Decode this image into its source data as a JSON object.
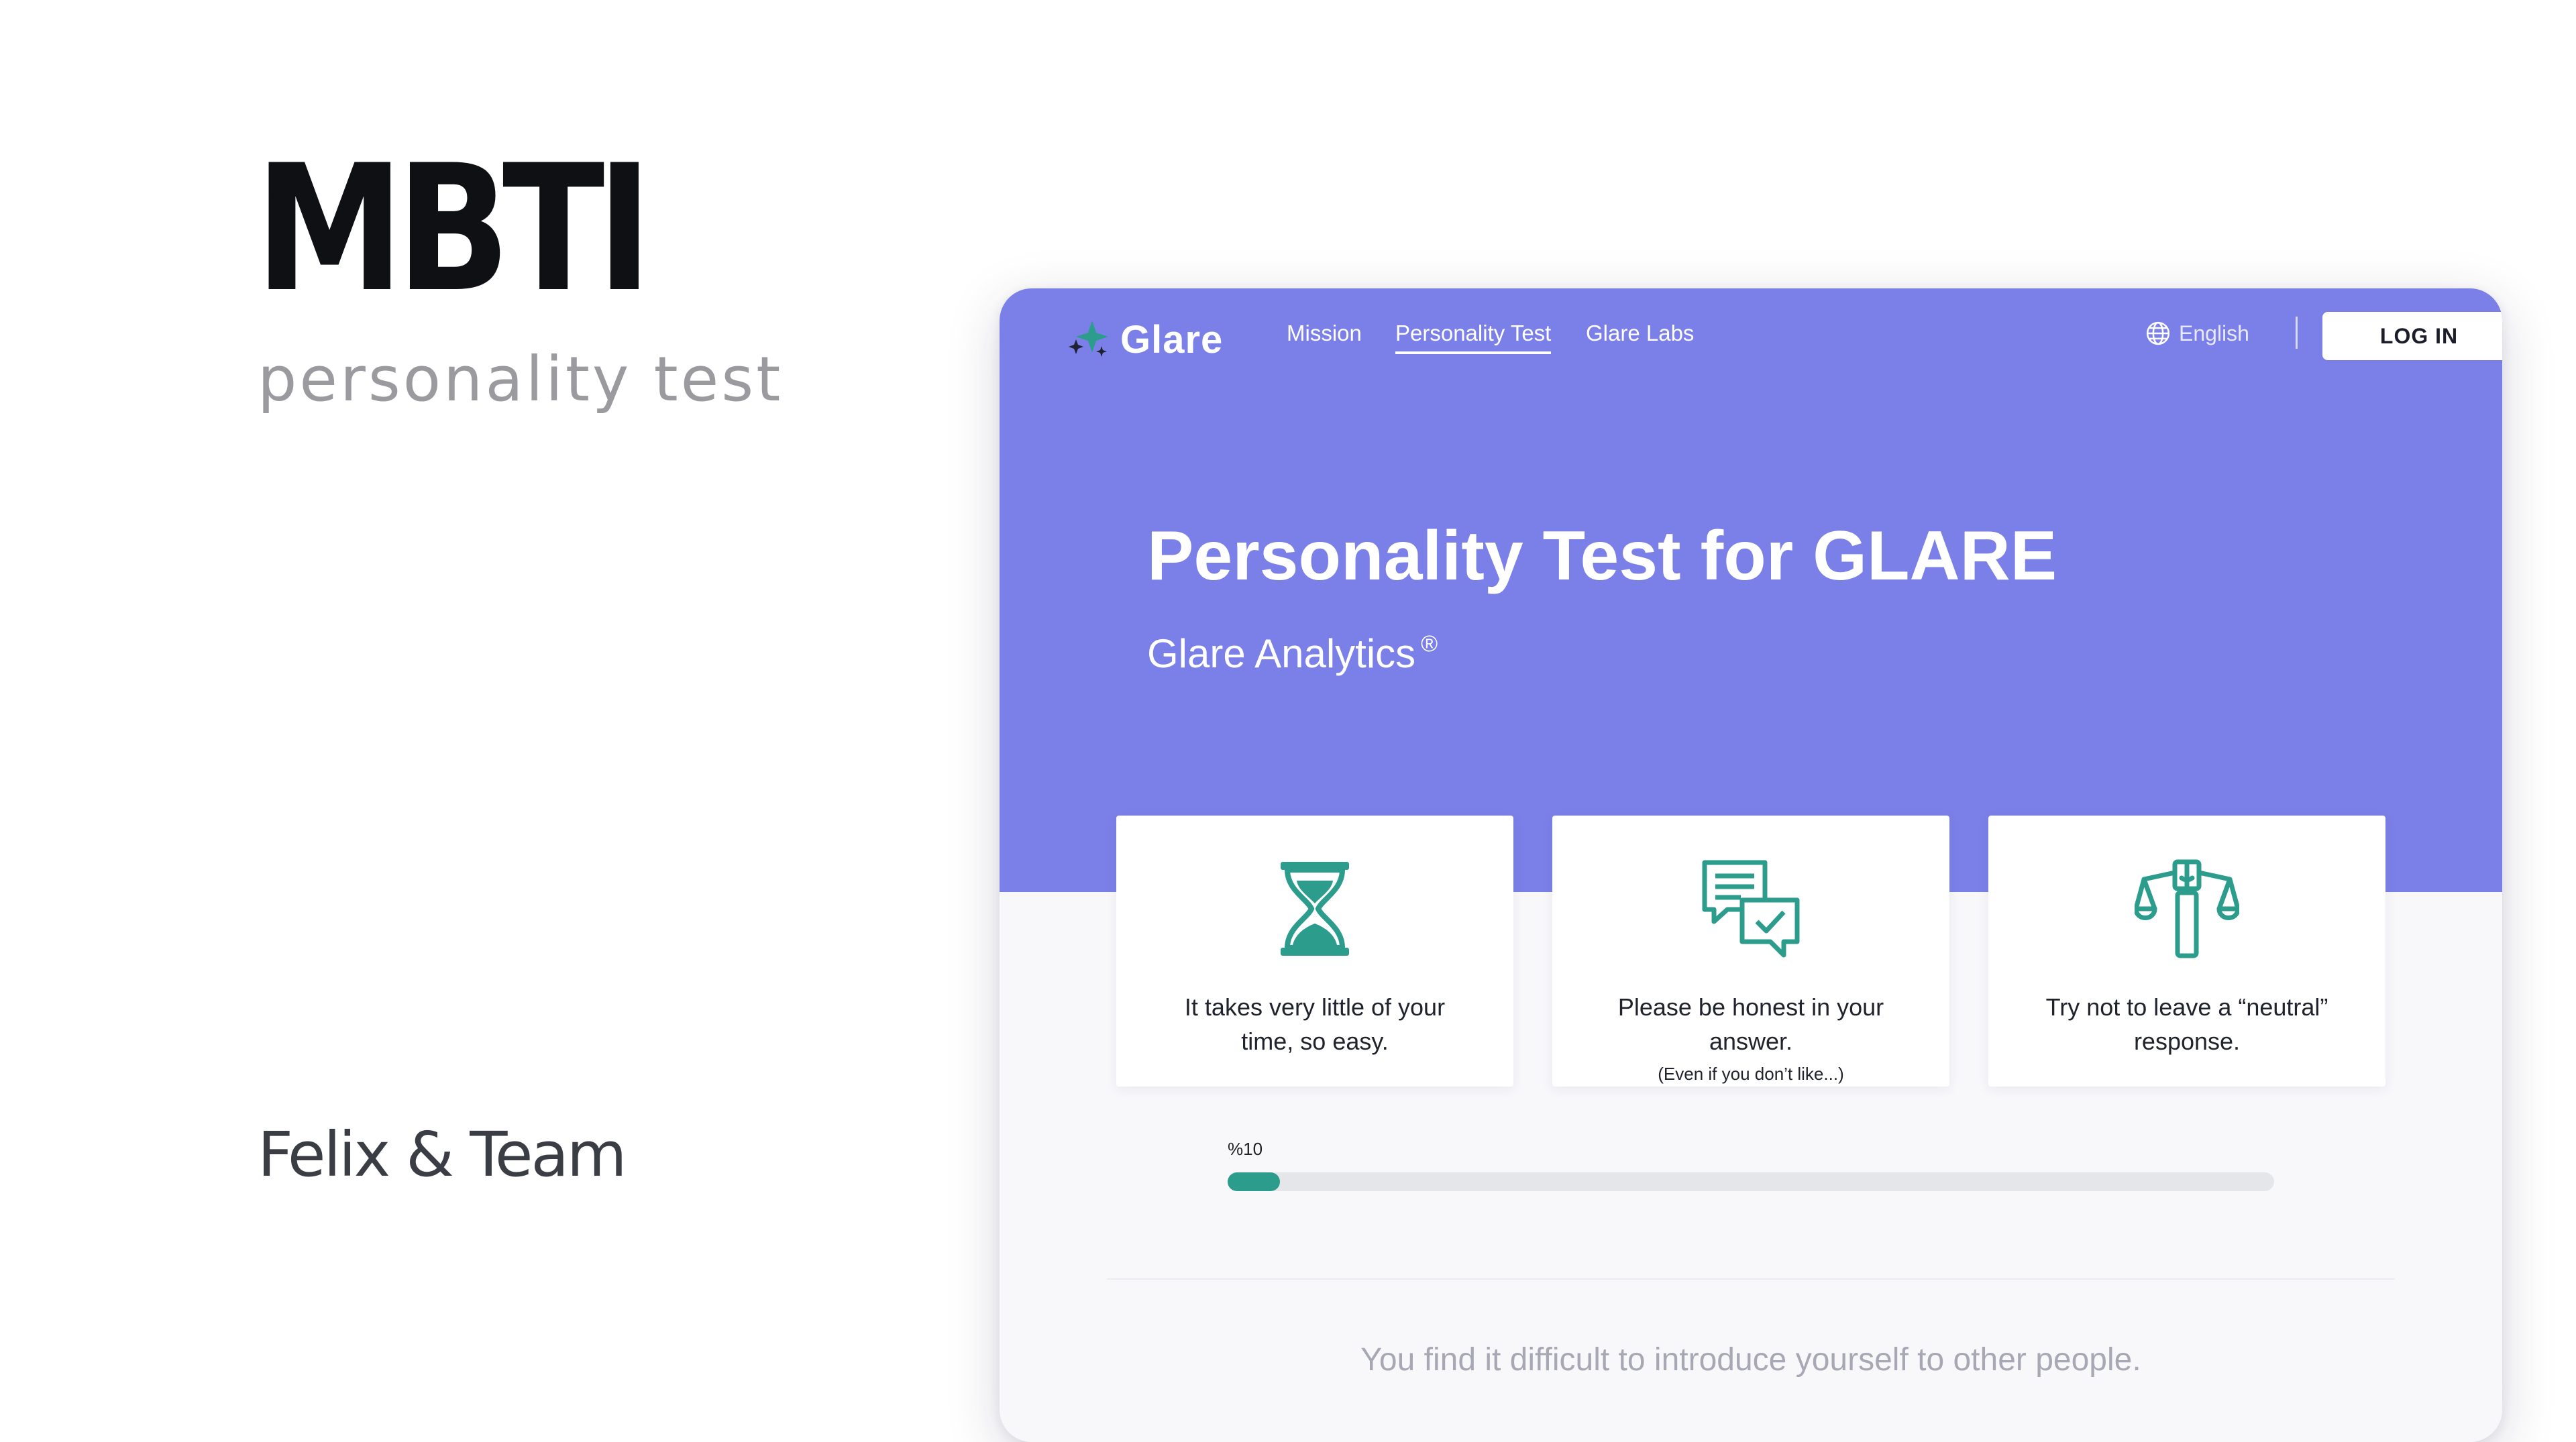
{
  "showcase": {
    "title": "MBTI",
    "subtitle": "personality test",
    "credit": "Felix & Team"
  },
  "nav": {
    "logo_text": "Glare",
    "links": [
      "Mission",
      "Personality Test",
      "Glare Labs"
    ],
    "active_link": "Personality Test",
    "language": "English",
    "login_label": "LOG IN"
  },
  "hero": {
    "title": "Personality Test for GLARE",
    "subtitle": "Glare Analytics",
    "registered_mark": "®"
  },
  "cards": [
    {
      "icon": "hourglass-icon",
      "line1": "It takes very little of your",
      "line2": "time, so easy."
    },
    {
      "icon": "chat-bubbles-icon",
      "line1": "Please be honest in your answer.",
      "note": "(Even if you don’t like...)"
    },
    {
      "icon": "scales-icon",
      "line1": "Try not to leave a “neutral”",
      "line2": "response."
    }
  ],
  "progress": {
    "label": "%10",
    "value_percent": 5
  },
  "question": {
    "text": "You find it difficult to introduce yourself to other people."
  },
  "colors": {
    "brand_purple": "#7b80e8",
    "accent_teal": "#2c9c8c",
    "track_gray": "#e5e6ea"
  }
}
